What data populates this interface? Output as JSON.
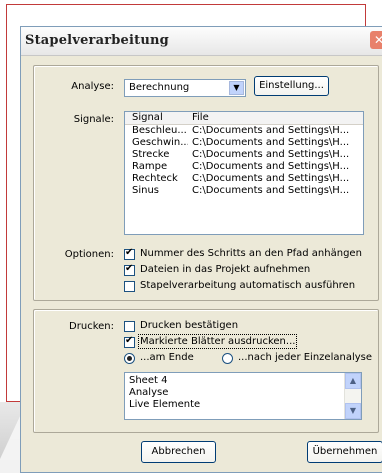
{
  "window": {
    "title": "Stapelverarbeitung"
  },
  "analyse": {
    "label": "Analyse:",
    "value": "Berechnung",
    "settings_button": "Einstellung..."
  },
  "signals": {
    "label": "Signale:",
    "columns": [
      "Signal",
      "File"
    ],
    "rows": [
      {
        "signal": "Beschleu...",
        "file": "C:\\Documents and Settings\\H..."
      },
      {
        "signal": "Geschwin...",
        "file": "C:\\Documents and Settings\\H..."
      },
      {
        "signal": "Strecke",
        "file": "C:\\Documents and Settings\\H..."
      },
      {
        "signal": "Rampe",
        "file": "C:\\Documents and Settings\\H..."
      },
      {
        "signal": "Rechteck",
        "file": "C:\\Documents and Settings\\H..."
      },
      {
        "signal": "Sinus",
        "file": "C:\\Documents and Settings\\H..."
      }
    ]
  },
  "options": {
    "label": "Optionen:",
    "items": [
      {
        "label": "Nummer des Schritts an den Pfad anhängen",
        "checked": true
      },
      {
        "label": "Dateien in das Projekt aufnehmen",
        "checked": true
      },
      {
        "label": "Stapelverarbeitung automatisch ausführen",
        "checked": false
      }
    ]
  },
  "print": {
    "label": "Drucken:",
    "confirm": {
      "label": "Drucken bestätigen",
      "checked": false
    },
    "marked": {
      "label": "Markierte Blätter ausdrucken...",
      "checked": true
    },
    "radios": [
      {
        "label": "...am Ende",
        "selected": true
      },
      {
        "label": "...nach jeder Einzelanalyse",
        "selected": false
      }
    ],
    "sheets": [
      "Sheet 4",
      "Analyse",
      "Live Elemente"
    ]
  },
  "buttons": {
    "cancel": "Abbrechen",
    "apply": "Übernehmen"
  }
}
